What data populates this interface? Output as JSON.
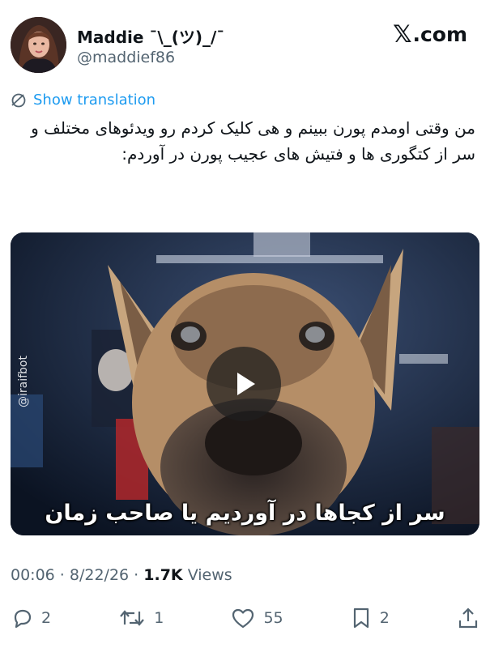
{
  "author": {
    "display_name": "Maddie ¯\\_(ツ)_/¯",
    "handle": "@maddief86",
    "avatar_icon": "avatar-portrait"
  },
  "brand": {
    "x_glyph": "𝕏",
    "suffix": ".com"
  },
  "translate": {
    "label": "Show translation",
    "icon": "globe-slash-icon",
    "color": "#1d9bf0"
  },
  "tweet": {
    "text": "من وقتی اومدم پورن ببینم و هی کلیک کردم رو ویدئوهای مختلف و سر از کتگوری ها و فتیش های عجیب پورن در آوردم:"
  },
  "media": {
    "caption": "سر از کجاها در آوردیم یا صاحب زمان",
    "watermark": "@iraifbot",
    "play_icon": "play-icon"
  },
  "meta": {
    "time": "00:06",
    "sep1": " · ",
    "date": "8/22/26",
    "sep2": " · ",
    "views_count": "1.7K",
    "views_label": " Views"
  },
  "actions": {
    "replies": "2",
    "reposts": "1",
    "likes": "55",
    "bookmarks": "2"
  },
  "colors": {
    "text": "#0f1419",
    "secondary": "#536471",
    "accent": "#1d9bf0"
  }
}
